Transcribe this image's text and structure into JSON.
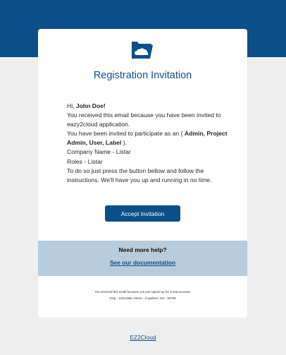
{
  "header": {
    "title": "Registration Invitation",
    "logo_icon": "cloud-folder-icon"
  },
  "message": {
    "greeting_prefix": "Hi, ",
    "recipient_name": "John Doe!",
    "line1": "You received this email because you have been invited to eazy2cloud application.",
    "line2_prefix": "You have been invited to participate as an { ",
    "roles_bold": "Admin, Project Admin, User, Label",
    "line2_suffix": " }.",
    "company": "Company Name - Listar",
    "roles": "Roles - Listar",
    "instructions": "To do so just press the button bellow and follow the instructions. We'll have you up and running in no time."
  },
  "cta": {
    "label": "Accept Invitation"
  },
  "help": {
    "title": "Need more help?",
    "link_label": "See our documentation"
  },
  "footer": {
    "line1": "You received this email because you just signed up for a new account.",
    "line2": "Ozaj - 1234 Main Street - Anywhere, MA - 56789"
  },
  "brand_link": "EZ2Cloud",
  "colors": {
    "brand": "#0b4f8a",
    "help_bg": "#b7ccdd",
    "page_bg": "#eeeeee"
  }
}
